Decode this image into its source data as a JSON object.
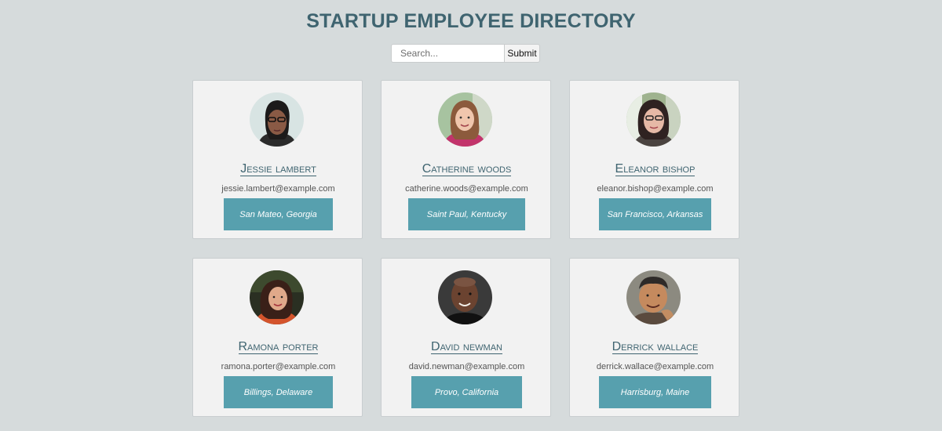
{
  "header": {
    "title": "STARTUP EMPLOYEE DIRECTORY"
  },
  "search": {
    "placeholder": "Search...",
    "value": "",
    "submit_label": "Submit"
  },
  "employees": [
    {
      "name": "Jessie lambert",
      "email": "jessie.lambert@example.com",
      "location": "San Mateo, Georgia",
      "avatar": "avatar-jessie"
    },
    {
      "name": "Catherine woods",
      "email": "catherine.woods@example.com",
      "location": "Saint Paul, Kentucky",
      "avatar": "avatar-catherine"
    },
    {
      "name": "Eleanor bishop",
      "email": "eleanor.bishop@example.com",
      "location": "San Francisco, Arkansas",
      "avatar": "avatar-eleanor"
    },
    {
      "name": "Ramona porter",
      "email": "ramona.porter@example.com",
      "location": "Billings, Delaware",
      "avatar": "avatar-ramona"
    },
    {
      "name": "David newman",
      "email": "david.newman@example.com",
      "location": "Provo, California",
      "avatar": "avatar-david"
    },
    {
      "name": "Derrick wallace",
      "email": "derrick.wallace@example.com",
      "location": "Harrisburg, Maine",
      "avatar": "avatar-derrick"
    }
  ],
  "colors": {
    "background": "#d6dbdc",
    "card": "#f2f2f2",
    "accent": "#57a0ae",
    "title": "#3f6470"
  }
}
